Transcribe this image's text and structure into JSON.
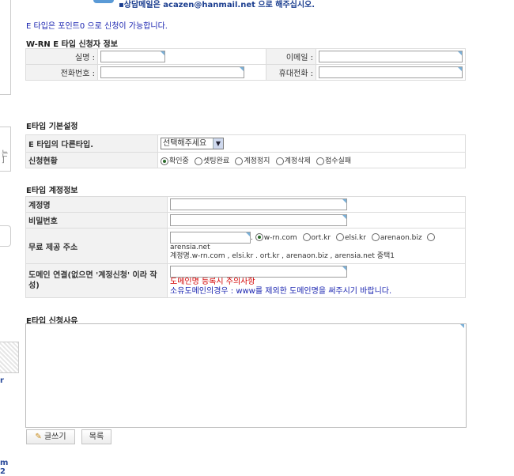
{
  "header": {
    "consult_notice": "상담메일은 acazen@hanmail.net 으로 해주십시오.",
    "point_notice": "E 타입은 포인트0 으로 신청이 가능합니다."
  },
  "sidebar": {
    "text1": "는",
    "text2": "]",
    "text3": "r",
    "text4": "m",
    "text5": "2"
  },
  "applicant": {
    "title": "W-RN E 타입 신청자 정보",
    "name_label": "실명 :",
    "email_label": "이메일 :",
    "phone_label": "전화번호 :",
    "mobile_label": "휴대전화 :",
    "name_value": "",
    "email_value": "",
    "phone_value": "",
    "mobile_value": ""
  },
  "basic": {
    "title": "E타입 기본설정",
    "other_type_label": "E 타입의 다른타입.",
    "select_value": "선택해주세요",
    "status_label": "신청현황",
    "status_options": [
      "확인중",
      "셋팅완료",
      "계정정지",
      "계정삭제",
      "접수실패"
    ],
    "status_selected": 0
  },
  "account": {
    "title": "E타입 계정정보",
    "account_label": "계정명",
    "password_label": "비밀번호",
    "free_addr_label": "무료 제공 주소",
    "domains": [
      "w-rn.com",
      "ort.kr",
      "elsi.kr",
      "arenaon.biz",
      "arensia.net"
    ],
    "domain_selected": 0,
    "dup_note": "계정명.w-rn.com , elsi.kr . ort.kr , arenaon.biz , arensia.net 중택1",
    "domain_link_label": "도메인 연결(없으면 '계정신청' 이라 작성)",
    "domain_warn": "도메인명 등록시 주의사항",
    "domain_hint": "소유도메인의경우 : www를 제외한 도메인명을 써주시기 바랍니다."
  },
  "reason": {
    "title": "E타입 신청사유",
    "value": ""
  },
  "buttons": {
    "write": "글쓰기",
    "list": "목록"
  }
}
